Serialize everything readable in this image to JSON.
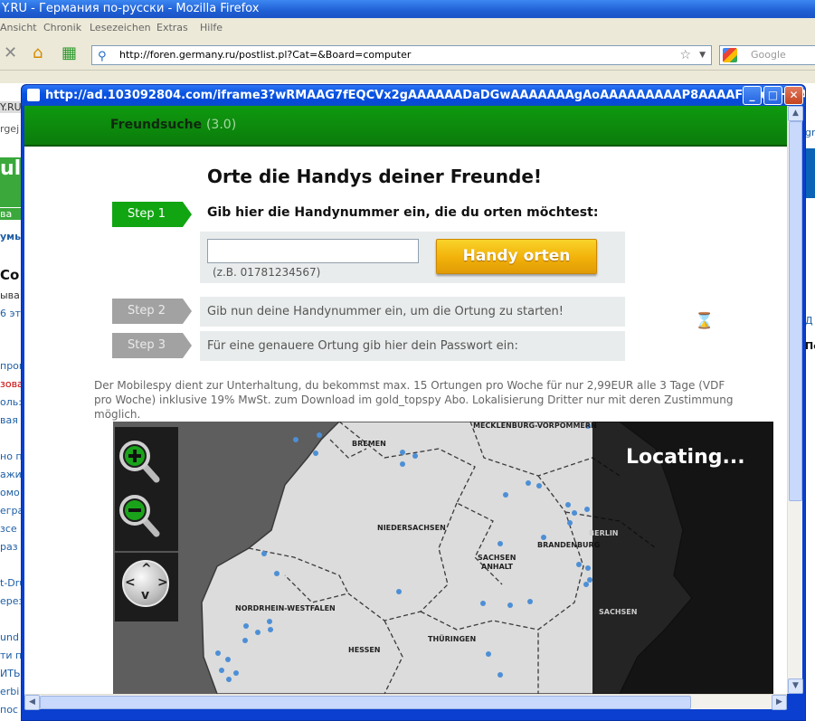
{
  "browser": {
    "title": "Y.RU - Германия по-русски - Mozilla Firefox",
    "menu": [
      "Ansicht",
      "Chronik",
      "Lesezeichen",
      "Extras",
      "Hilfe"
    ],
    "url": "http://foren.germany.ru/postlist.pl?Cat=&Board=computer",
    "search_placeholder": "Google",
    "bookmarks_partial": "Y.RU"
  },
  "background_fragments": {
    "left": [
      "rgej",
      "ul",
      "ва",
      "умь",
      "Co",
      "ыва",
      "6 эт",
      "прог",
      "зова",
      "оль:",
      "вая",
      "но п",
      "ажи",
      "омо",
      "егра",
      "зсе",
      "раз",
      "t-Dru",
      "ерез",
      "und",
      "ти п",
      "ИТЬ",
      "erbi",
      "пос"
    ],
    "right": [
      "gr",
      "Д",
      "Пс"
    ]
  },
  "popup": {
    "title": "http://ad.103092804.com/iframe3?wRMAAG7fEQCVx2gAAAAAADaDGwAAAAAAAgAoAAAAAAAAAP8AAAAFFHuGHQAAAAA - M...",
    "header_title": "Freundsuche",
    "header_version": "(3.0)",
    "heading": "Orte die Handys deiner Freunde!",
    "step1_label": "Step 1",
    "step1_text": "Gib hier die Handynummer ein, die du orten möchtest:",
    "phone_value": "",
    "phone_hint": "(z.B. 01781234567)",
    "orten_button": "Handy orten",
    "step2_label": "Step 2",
    "step2_text": "Gib nun deine Handynummer ein, um die Ortung zu starten!",
    "step3_label": "Step 3",
    "step3_text": "Für eine genauere Ortung gib hier dein Passwort ein:",
    "disclaimer": "Der Mobilespy dient zur Unterhaltung, du bekommst max. 15 Ortungen pro Woche für nur 2,99EUR alle 3 Tage (VDF pro Woche) inklusive 19% MwSt. zum Download im gold_topspy Abo. Lokalisierung Dritter nur mit deren Zustimmung möglich.",
    "locating_text": "Locating...",
    "regions": {
      "mecklenburg": "MECKLENBURG-VORPOMMERN",
      "bremen": "BREMEN",
      "niedersachsen": "NIEDERSACHSEN",
      "berlin": "BERLIN",
      "brandenburg": "BRANDENBURG",
      "sachsen_anhalt_1": "SACHSEN",
      "sachsen_anhalt_2": "ANHALT",
      "nrw": "NORDRHEIN-WESTFALEN",
      "hessen": "HESSEN",
      "thueringen": "THÜRINGEN",
      "sachsen": "SACHSEN"
    }
  },
  "colors": {
    "header_green": "#0b7c0b",
    "step_active": "#11a511",
    "step_inactive": "#a2a2a2",
    "button_orange": "#f2b10a",
    "dot_blue": "#4d8fd6"
  }
}
